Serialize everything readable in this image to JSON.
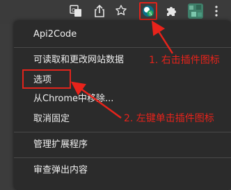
{
  "toolbar": {
    "icons": [
      "translate-icon",
      "share-icon",
      "star-icon",
      "extension-icon",
      "puzzle-icon",
      "avatar",
      "menu-icon"
    ],
    "highlight_color": "#e0241c"
  },
  "menu": {
    "items": [
      {
        "label": "Api2Code"
      },
      {
        "label": "可读取和更改网站数据"
      },
      {
        "label": "选项"
      },
      {
        "label": "从Chrome中移除..."
      },
      {
        "label": "取消固定"
      },
      {
        "label": "管理扩展程序"
      },
      {
        "label": "审查弹出内容"
      }
    ]
  },
  "annotations": {
    "step1": "1. 右击插件图标",
    "step2": "2. 左键单击插件图标",
    "color": "#e8231b"
  }
}
